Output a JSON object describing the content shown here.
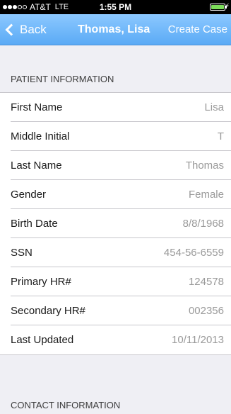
{
  "status_bar": {
    "carrier": "AT&T",
    "network": "LTE",
    "time": "1:55 PM"
  },
  "nav": {
    "back_label": "Back",
    "title": "Thomas, Lisa",
    "action_label": "Create Case"
  },
  "patient_section": {
    "header": "PATIENT INFORMATION",
    "rows": [
      {
        "label": "First Name",
        "value": "Lisa"
      },
      {
        "label": "Middle Initial",
        "value": "T"
      },
      {
        "label": "Last Name",
        "value": "Thomas"
      },
      {
        "label": "Gender",
        "value": "Female"
      },
      {
        "label": "Birth Date",
        "value": "8/8/1968"
      },
      {
        "label": "SSN",
        "value": "454-56-6559"
      },
      {
        "label": "Primary HR#",
        "value": "124578"
      },
      {
        "label": "Secondary HR#",
        "value": "002356"
      },
      {
        "label": "Last Updated",
        "value": "10/11/2013"
      }
    ]
  },
  "contact_section": {
    "header": "CONTACT INFORMATION"
  },
  "colors": {
    "nav_background": "#6fb7fb",
    "value_text": "#9a9a9a",
    "battery_fill": "#7cdc5a"
  }
}
